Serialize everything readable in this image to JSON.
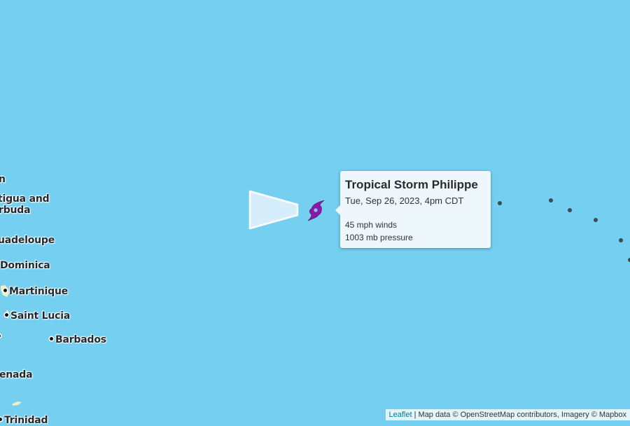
{
  "map": {
    "water_color": "#74cff0",
    "land_color": "#f2efc2",
    "cone_fill": "#d6eefb",
    "storm_icon_color": "#8b19a6",
    "place_labels": [
      "n",
      "tigua and",
      "rbuda",
      "uadeloupe",
      "Dominica",
      "Martinique",
      "Saint Lucia",
      "Barbados",
      "enada",
      "Trinidad"
    ]
  },
  "popup": {
    "title": "Tropical Storm Philippe",
    "datetime": "Tue, Sep 26, 2023, 4pm CDT",
    "winds": "45 mph winds",
    "pressure": "1003 mb pressure"
  },
  "attribution": {
    "leaflet_link": "Leaflet",
    "separator": " | ",
    "text": "Map data © OpenStreetMap contributors, Imagery © Mapbox"
  }
}
